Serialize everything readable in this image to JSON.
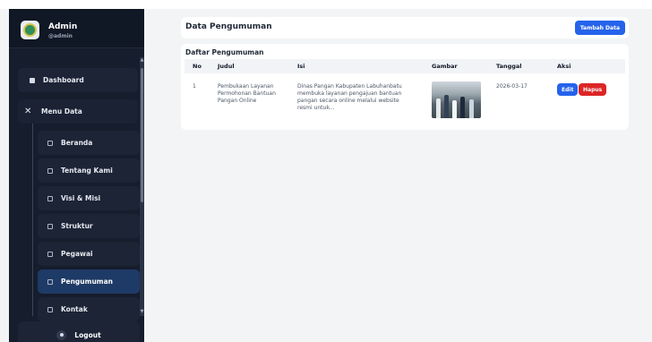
{
  "sidebar": {
    "profile": {
      "name": "Admin",
      "username": "@admin"
    },
    "dashboard_label": "Dashboard",
    "menu_label": "Menu Data",
    "submenu": [
      {
        "label": "Beranda"
      },
      {
        "label": "Tentang Kami"
      },
      {
        "label": "Visi & Misi"
      },
      {
        "label": "Struktur"
      },
      {
        "label": "Pegawai"
      },
      {
        "label": "Pengumuman",
        "active": true
      },
      {
        "label": "Kontak"
      }
    ],
    "logout_label": "Logout"
  },
  "header": {
    "title": "Data Pengumuman",
    "add_button": "Tambah Data"
  },
  "table": {
    "title": "Daftar Pengumuman",
    "columns": [
      "No",
      "Judul",
      "Isi",
      "Gambar",
      "Tanggal",
      "Aksi"
    ],
    "rows": [
      {
        "no": "1",
        "judul_1": "Pembukaan Layanan",
        "judul_2": "Permohonan Bantuan",
        "judul_3": "Pangan Online",
        "isi_1": "Dinas Pangan Kabupaten Labuhanbatu",
        "isi_2": "membuka layanan pengajuan bantuan",
        "isi_3": "pangan secara online melalui website",
        "isi_4": "resmi untuk...",
        "tanggal": "2026-03-17",
        "edit": "Edit",
        "hapus": "Hapus"
      }
    ]
  },
  "colors": {
    "sidebar": "#161d2c",
    "primary": "#2563eb",
    "danger": "#dc2626",
    "active_item": "#1e3a66"
  }
}
